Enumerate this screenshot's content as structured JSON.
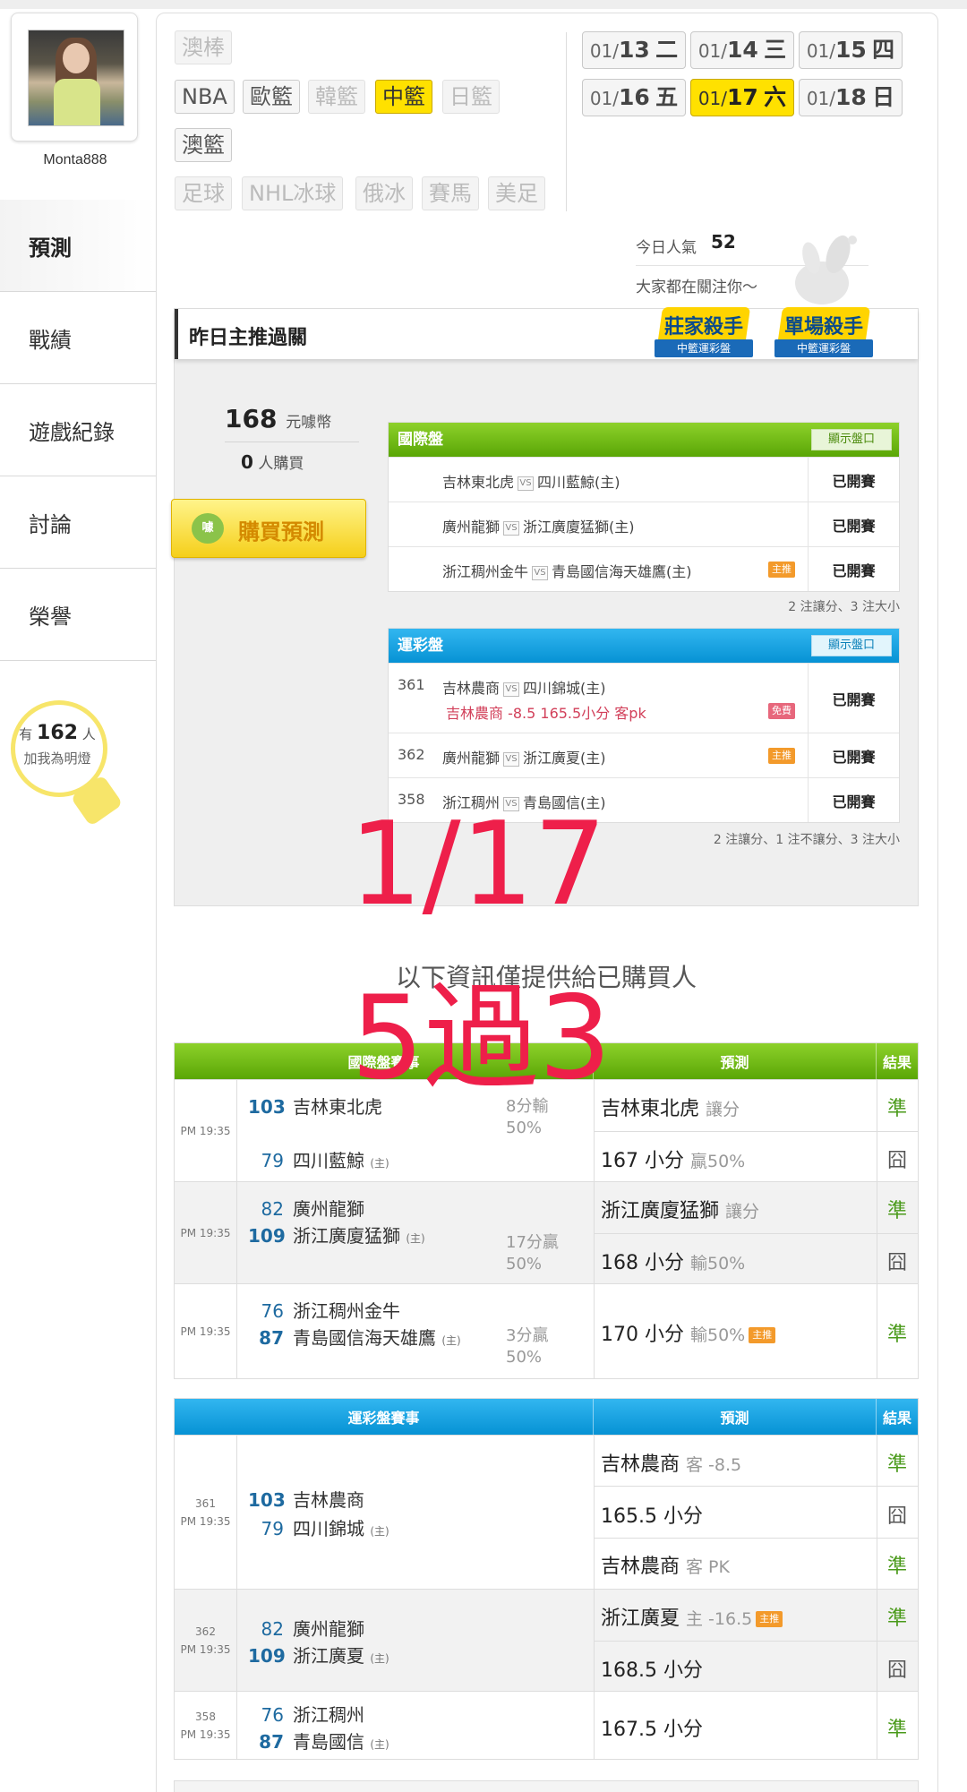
{
  "user": {
    "name": "Monta888"
  },
  "nav": {
    "items": [
      "預測",
      "戰績",
      "遊戲紀錄",
      "討論",
      "榮譽"
    ]
  },
  "light": {
    "prefix": "有",
    "count": "162",
    "suffix": "人",
    "cta": "加我為明燈"
  },
  "categories": {
    "row1": [
      "澳棒"
    ],
    "row2": [
      "NBA",
      "歐籃",
      "韓籃",
      "中籃",
      "日籃"
    ],
    "row3": [
      "澳籃"
    ],
    "row4": [
      "足球",
      "NHL冰球",
      "俄冰",
      "賽馬",
      "美足"
    ],
    "active": "中籃"
  },
  "dates": [
    {
      "md": "01/",
      "d": "13",
      "w": "二"
    },
    {
      "md": "01/",
      "d": "14",
      "w": "三"
    },
    {
      "md": "01/",
      "d": "15",
      "w": "四"
    },
    {
      "md": "01/",
      "d": "16",
      "w": "五"
    },
    {
      "md": "01/",
      "d": "17",
      "w": "六",
      "active": true
    },
    {
      "md": "01/",
      "d": "18",
      "w": "日"
    }
  ],
  "popularity": {
    "label": "今日人氣",
    "value": "52",
    "note": "大家都在關注你〜"
  },
  "rec": {
    "title": "昨日主推過關",
    "badge1": {
      "title": "莊家殺手",
      "sub": "中籃運彩盤"
    },
    "badge2": {
      "title": "單場殺手",
      "sub": "中籃運彩盤"
    },
    "price": "168",
    "price_unit": "元噱幣",
    "buyers": "0",
    "buyers_unit": "人購買",
    "buy_label": "購買預測",
    "buy_icon": "噱"
  },
  "intl": {
    "title": "國際盤",
    "show": "顯示盤口",
    "rows": [
      {
        "away": "吉林東北虎",
        "home": "四川藍鯨(主)",
        "status": "已開賽",
        "tag": ""
      },
      {
        "away": "廣州龍獅",
        "home": "浙江廣廈猛獅(主)",
        "status": "已開賽",
        "tag": ""
      },
      {
        "away": "浙江稠州金牛",
        "home": "青島國信海天雄鷹(主)",
        "status": "已開賽",
        "tag": "主推"
      }
    ],
    "note": "2 注讓分、3 注大小"
  },
  "lottery": {
    "title": "運彩盤",
    "show": "顯示盤口",
    "rows": [
      {
        "num": "361",
        "away": "吉林農商",
        "home": "四川錦城(主)",
        "status": "已開賽",
        "pred": "吉林農商 -8.5 165.5小分 客pk",
        "tag": "免費"
      },
      {
        "num": "362",
        "away": "廣州龍獅",
        "home": "浙江廣夏(主)",
        "status": "已開賽",
        "tag": "主推"
      },
      {
        "num": "358",
        "away": "浙江稠州",
        "home": "青島國信(主)",
        "status": "已開賽",
        "tag": ""
      }
    ],
    "note": "2 注讓分、1 注不讓分、3 注大小"
  },
  "overlay": {
    "date": "1/17",
    "record": "5過3"
  },
  "notice": "以下資訊僅提供給已購買人",
  "intl_results": {
    "headers": [
      "國際盤賽事",
      "預測",
      "結果"
    ],
    "tag_main": "主推",
    "games": [
      {
        "time": "PM 19:35",
        "away_score": "103",
        "away": "吉林東北虎",
        "home_score": "79",
        "home": "四川藍鯨",
        "home_mark": "(主)",
        "handicap1": "8分輸",
        "handicap2": "50%",
        "preds": [
          {
            "main": "吉林東北虎",
            "sub": "讓分",
            "result": "準"
          },
          {
            "main": "167 小分",
            "sub": "贏50%",
            "result": "囧"
          }
        ]
      },
      {
        "time": "PM 19:35",
        "away_score": "82",
        "away": "廣州龍獅",
        "home_score": "109",
        "home": "浙江廣廈猛獅",
        "home_mark": "(主)",
        "handicap1": "17分贏",
        "handicap2": "50%",
        "preds": [
          {
            "main": "浙江廣廈猛獅",
            "sub": "讓分",
            "result": "準"
          },
          {
            "main": "168 小分",
            "sub": "輸50%",
            "result": "囧"
          }
        ]
      },
      {
        "time": "PM 19:35",
        "away_score": "76",
        "away": "浙江稠州金牛",
        "home_score": "87",
        "home": "青島國信海天雄鷹",
        "home_mark": "(主)",
        "handicap1": "3分贏",
        "handicap2": "50%",
        "preds": [
          {
            "main": "170 小分",
            "sub": "輸50%",
            "result": "準"
          }
        ]
      }
    ]
  },
  "lottery_results": {
    "headers": [
      "運彩盤賽事",
      "預測",
      "結果"
    ],
    "tag_main": "主推",
    "games": [
      {
        "num": "361",
        "time": "PM 19:35",
        "away_score": "103",
        "away": "吉林農商",
        "home_score": "79",
        "home": "四川錦城",
        "home_mark": "(主)",
        "preds": [
          {
            "main": "吉林農商",
            "sub": "客 -8.5",
            "result": "準"
          },
          {
            "main": "165.5 小分",
            "sub": "",
            "result": "囧"
          },
          {
            "main": "吉林農商",
            "sub": "客 PK",
            "result": "準"
          }
        ]
      },
      {
        "num": "362",
        "time": "PM 19:35",
        "away_score": "82",
        "away": "廣州龍獅",
        "home_score": "109",
        "home": "浙江廣夏",
        "home_mark": "(主)",
        "preds": [
          {
            "main": "浙江廣夏",
            "sub": "主 -16.5",
            "result": "準"
          },
          {
            "main": "168.5 小分",
            "sub": "",
            "result": "囧"
          }
        ]
      },
      {
        "num": "358",
        "time": "PM 19:35",
        "away_score": "76",
        "away": "浙江稠州",
        "home_score": "87",
        "home": "青島國信",
        "home_mark": "(主)",
        "preds": [
          {
            "main": "167.5 小分",
            "sub": "",
            "result": "準"
          }
        ]
      }
    ]
  }
}
